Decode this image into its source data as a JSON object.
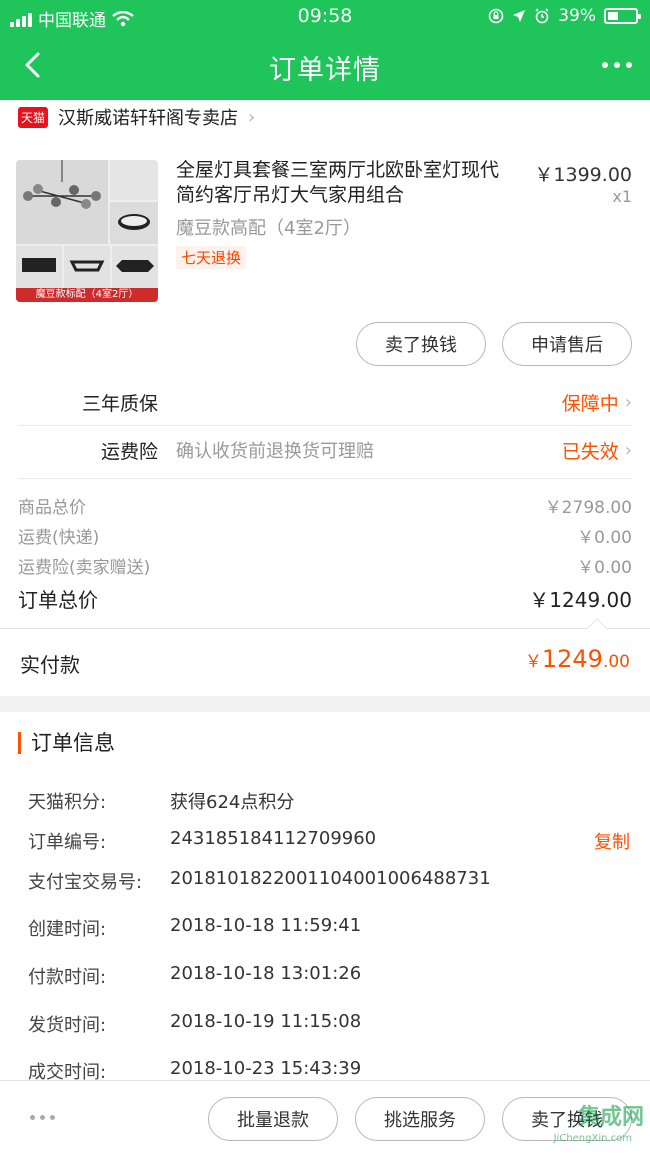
{
  "status_bar": {
    "carrier": "中国联通",
    "time": "09:58",
    "battery": "39%"
  },
  "nav": {
    "title": "订单详情"
  },
  "shop": {
    "badge": "天猫",
    "name": "汉斯威诺轩轩阁专卖店"
  },
  "product": {
    "name": "全屋灯具套餐三室两厅北欧卧室灯现代简约客厅吊灯大气家用组合",
    "variant": "魔豆款高配（4室2厅）",
    "tag": "七天退换",
    "price": "￥1399.00",
    "qty": "x1",
    "thumb_caption": "魔豆款标配（4室2厅）"
  },
  "product_actions": {
    "sell": "卖了换钱",
    "after_sale": "申请售后"
  },
  "services": [
    {
      "label": "三年质保",
      "desc": "",
      "status": "保障中"
    },
    {
      "label": "运费险",
      "desc": "确认收货前退换货可理赔",
      "status": "已失效"
    }
  ],
  "fees": [
    {
      "label": "商品总价",
      "value": "￥2798.00"
    },
    {
      "label": "运费(快递)",
      "value": "￥0.00"
    },
    {
      "label": "运费险(卖家赠送)",
      "value": "￥0.00"
    }
  ],
  "order_total": {
    "label": "订单总价",
    "value": "￥1249.00"
  },
  "payment": {
    "label": "实付款",
    "currency": "￥",
    "integer": "1249",
    "decimal": ".00"
  },
  "order_info": {
    "title": "订单信息",
    "copy_label": "复制",
    "rows": [
      {
        "key": "天猫积分:",
        "value": "获得624点积分"
      },
      {
        "key": "订单编号:",
        "value": "243185184112709960"
      },
      {
        "key": "支付宝交易号:",
        "value": "2018101822001104001006488731"
      },
      {
        "key": "创建时间:",
        "value": "2018-10-18 11:59:41"
      },
      {
        "key": "付款时间:",
        "value": "2018-10-18 13:01:26"
      },
      {
        "key": "发货时间:",
        "value": "2018-10-19 11:15:08"
      },
      {
        "key": "成交时间:",
        "value": "2018-10-23 15:43:39"
      }
    ]
  },
  "bottom_bar": {
    "batch_refund": "批量退款",
    "pick_service": "挑选服务",
    "sell": "卖了换钱"
  },
  "watermark": {
    "text": "集成网",
    "url": "JiChengXin.com"
  },
  "colors": {
    "brand_green": "#1fc55a",
    "accent_orange": "#ff5000",
    "tmall_red": "#e8121e"
  }
}
